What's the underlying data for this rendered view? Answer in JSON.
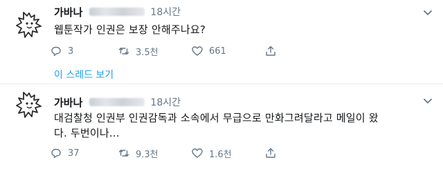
{
  "tweets": [
    {
      "author": "가바나",
      "time": "18시간",
      "text": "웹툰작가 인권은 보장 안해주나요?",
      "replies": "3",
      "retweets": "3.5천",
      "likes": "661"
    },
    {
      "author": "가바나",
      "time": "18시간",
      "text": "대검찰청 인권부 인권감독과 소속에서 무급으로 만화그려달라고 메일이 왔\n다. 두번이나...",
      "replies": "37",
      "retweets": "9.3천",
      "likes": "1.6천"
    }
  ],
  "thread_link": "이 스레드 보기",
  "colors": {
    "link": "#1da1f2",
    "muted": "#657786",
    "divider": "#e6ecf0"
  },
  "icons": [
    "avatar-icon",
    "caret-down-icon",
    "reply-icon",
    "retweet-icon",
    "like-icon",
    "share-icon"
  ]
}
